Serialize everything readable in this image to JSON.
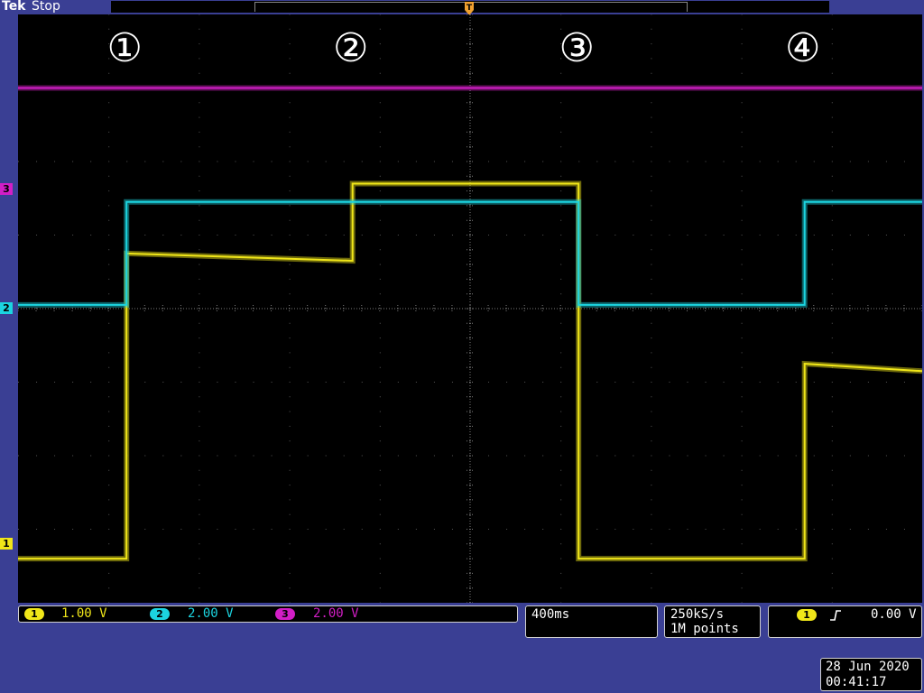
{
  "header": {
    "brand": "Tek",
    "acq_state": "Stop"
  },
  "trigger_marker": "T",
  "segment_labels": [
    "①",
    "②",
    "③",
    "④"
  ],
  "channels": [
    {
      "id": "1",
      "scale": "1.00 V",
      "color": "#f0e619"
    },
    {
      "id": "2",
      "scale": "2.00 V",
      "color": "#1cd4e0"
    },
    {
      "id": "3",
      "scale": "2.00 V",
      "color": "#d21ec6"
    }
  ],
  "timebase": "400ms",
  "sample_rate": "250kS/s",
  "record_length": "1M points",
  "trigger": {
    "source": "1",
    "slope_icon": "rising-edge-icon",
    "level": "0.00 V"
  },
  "date": "28 Jun 2020",
  "time": "00:41:17",
  "chart_data": {
    "type": "line",
    "x_divisions": 10,
    "y_divisions": 8,
    "time_per_div": "400ms",
    "grid": true,
    "segment_boundaries_div": [
      1.2,
      3.7,
      6.2,
      8.7
    ],
    "series": [
      {
        "name": "1",
        "volts_per_div": "1.00 V",
        "points": [
          [
            0,
            -3.4
          ],
          [
            1.2,
            -3.4
          ],
          [
            1.2,
            0.75
          ],
          [
            3.7,
            0.65
          ],
          [
            3.7,
            1.7
          ],
          [
            6.2,
            1.7
          ],
          [
            6.2,
            -3.4
          ],
          [
            8.7,
            -3.4
          ],
          [
            8.7,
            -0.75
          ],
          [
            10,
            -0.85
          ]
        ]
      },
      {
        "name": "2",
        "volts_per_div": "2.00 V",
        "points": [
          [
            0,
            0.05
          ],
          [
            1.2,
            0.05
          ],
          [
            1.2,
            1.45
          ],
          [
            6.2,
            1.45
          ],
          [
            6.2,
            0.05
          ],
          [
            8.7,
            0.05
          ],
          [
            8.7,
            1.45
          ],
          [
            10,
            1.45
          ]
        ]
      },
      {
        "name": "3",
        "volts_per_div": "2.00 V",
        "points": [
          [
            0,
            3.0
          ],
          [
            10,
            3.0
          ]
        ]
      }
    ]
  }
}
